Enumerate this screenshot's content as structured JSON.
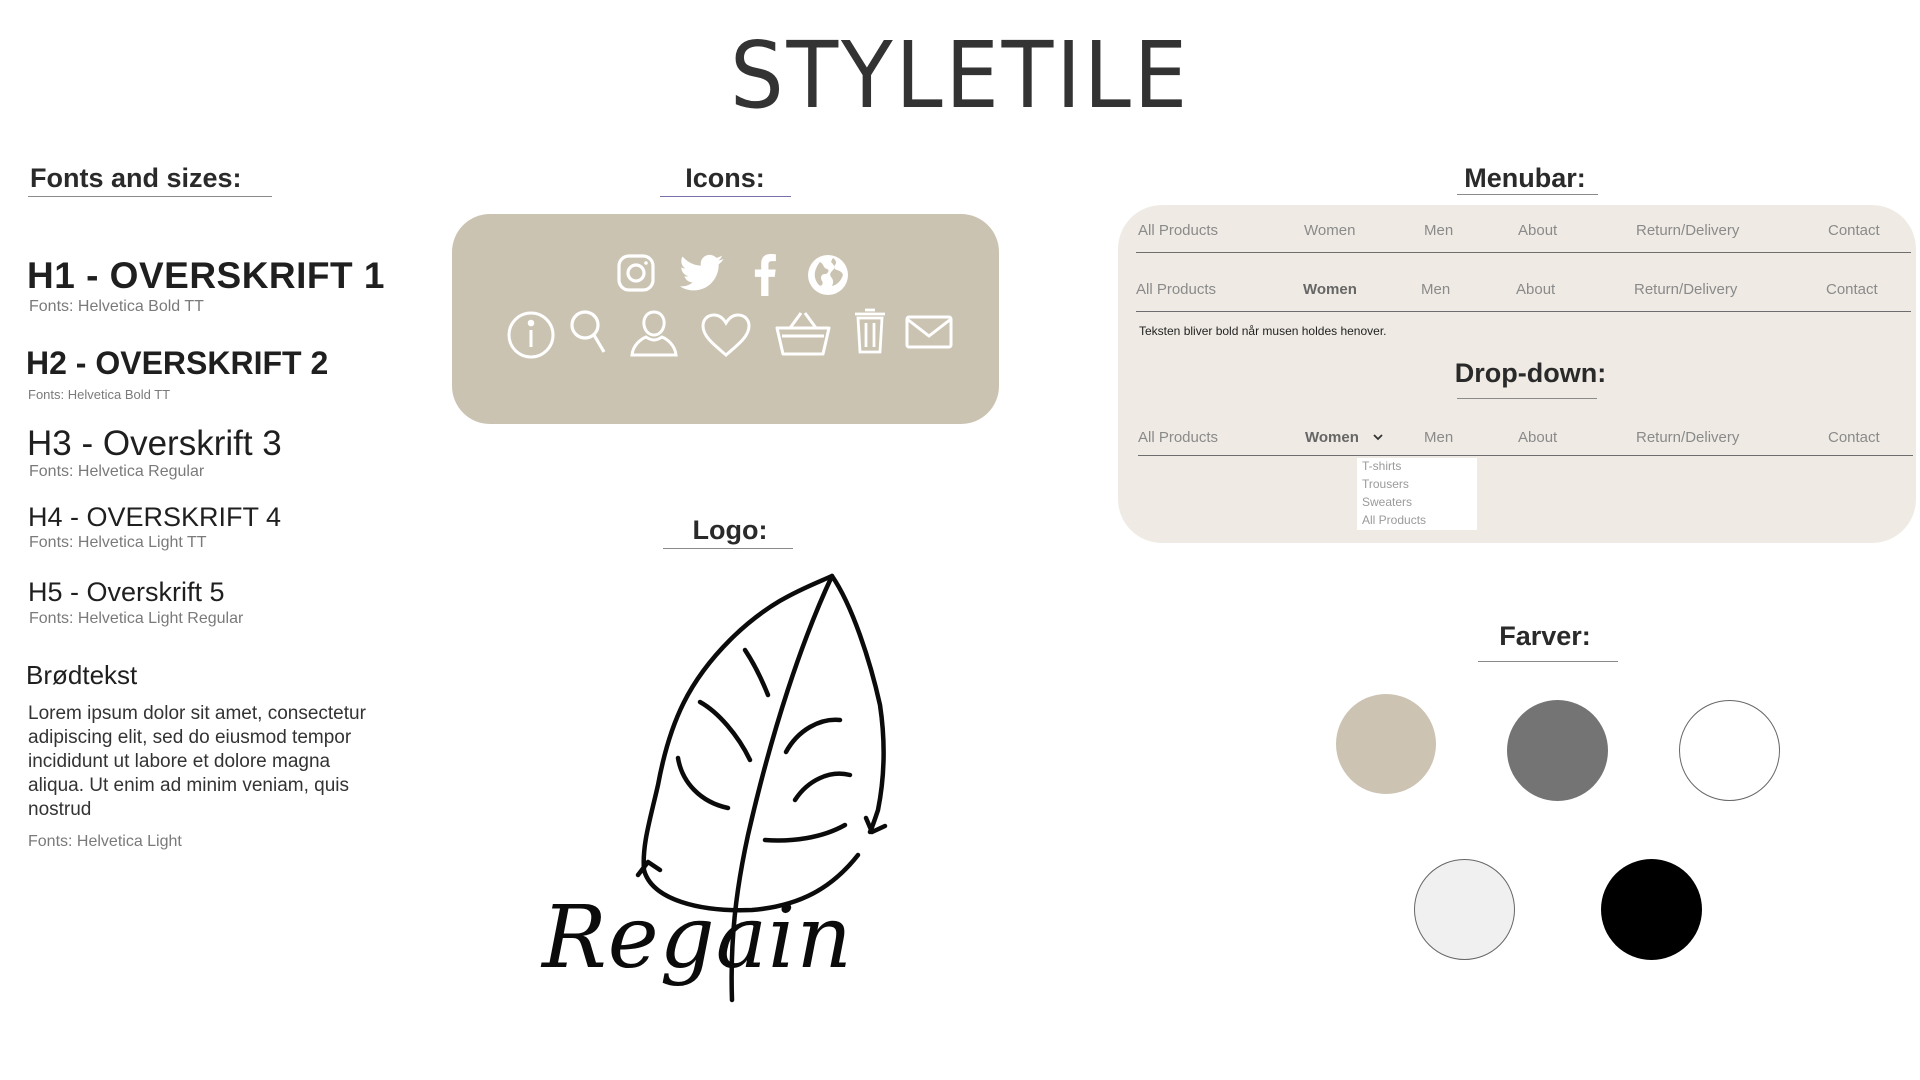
{
  "title": "STYLETILE",
  "fonts_section": {
    "heading": "Fonts and sizes:",
    "h1": {
      "text": "H1 - OVERSKRIFT 1",
      "font": "Fonts: Helvetica Bold TT"
    },
    "h2": {
      "text": "H2 - OVERSKRIFT 2",
      "font": "Fonts: Helvetica Bold TT"
    },
    "h3": {
      "text": "H3 - Overskrift 3",
      "font": "Fonts: Helvetica Regular"
    },
    "h4": {
      "text": "H4 - OVERSKRIFT 4",
      "font": "Fonts: Helvetica Light TT"
    },
    "h5": {
      "text": "H5 - Overskrift 5",
      "font": "Fonts: Helvetica Light Regular"
    },
    "body_title": "Brødtekst",
    "lorem": "Lorem ipsum dolor sit amet, consectetur adipiscing elit, sed do eiusmod tempor incididunt ut labore et dolore magna aliqua. Ut enim ad minim veniam, quis nostrud",
    "body_font": "Fonts: Helvetica Light"
  },
  "icons_section": {
    "heading": "Icons:",
    "panel_color": "#cbc3b2",
    "icons_row1": [
      "instagram-icon",
      "twitter-icon",
      "facebook-icon",
      "globe-icon"
    ],
    "icons_row2": [
      "info-icon",
      "search-icon",
      "user-icon",
      "heart-icon",
      "basket-icon",
      "trash-icon",
      "mail-icon"
    ]
  },
  "logo_section": {
    "heading": "Logo:",
    "logo_text": "Regain"
  },
  "menubar_section": {
    "heading": "Menubar:",
    "panel_color": "#efebe4",
    "items": [
      "All Products",
      "Women",
      "Men",
      "About",
      "Return/Delivery",
      "Contact"
    ],
    "hover_note": "Teksten bliver bold når musen holdes henover.",
    "dropdown_heading": "Drop-down:",
    "dropdown_items": [
      "T-shirts",
      "Trousers",
      "Sweaters",
      "All Products"
    ]
  },
  "colors_section": {
    "heading": "Farver:",
    "swatches": [
      "#ccc3b2",
      "#747474",
      "#ffffff",
      "#f0f0f0",
      "#000000"
    ]
  }
}
